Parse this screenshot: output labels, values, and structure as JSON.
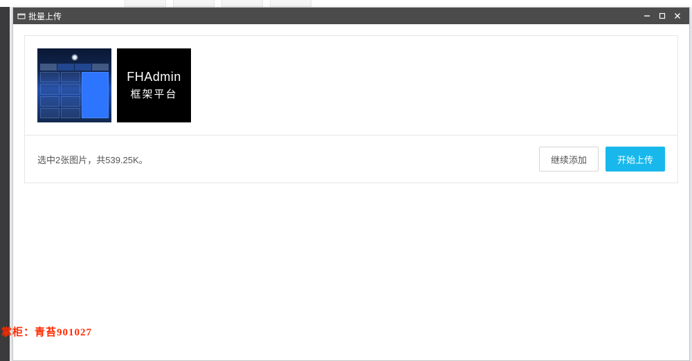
{
  "modal": {
    "title": "批量上传"
  },
  "thumbs": {
    "fhadmin_line1": "FHAdmin",
    "fhadmin_line2": "框架平台"
  },
  "status": {
    "text": "选中2张图片，共539.25K。"
  },
  "buttons": {
    "continue_add": "继续添加",
    "start_upload": "开始上传"
  },
  "watermark": {
    "label": "掌柜：",
    "value": "青苔901027"
  }
}
